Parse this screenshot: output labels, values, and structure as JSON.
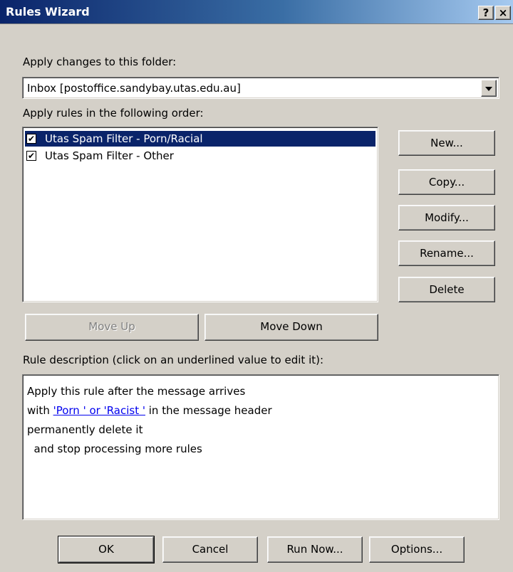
{
  "window": {
    "title": "Rules Wizard",
    "help_glyph": "?",
    "close_glyph": "×"
  },
  "folder": {
    "label": "Apply changes to this folder:",
    "value": "Inbox [postoffice.sandybay.utas.edu.au]"
  },
  "rules": {
    "label": "Apply rules in the following order:",
    "items": [
      {
        "label": "Utas Spam Filter - Porn/Racial",
        "checked": true,
        "selected": true
      },
      {
        "label": "Utas Spam Filter - Other",
        "checked": true,
        "selected": false
      }
    ]
  },
  "side_buttons": {
    "new": "New...",
    "copy": "Copy...",
    "modify": "Modify...",
    "rename": "Rename...",
    "delete": "Delete"
  },
  "move": {
    "up": "Move Up",
    "down": "Move Down"
  },
  "description": {
    "label": "Rule description (click on an underlined value to edit it):",
    "line1": "Apply this rule after the message arrives",
    "line2_prefix": "with ",
    "line2_link": "'Porn  ' or 'Racist  '",
    "line2_suffix": " in the message header",
    "line3": "permanently delete it",
    "line4": "  and stop processing more rules"
  },
  "footer": {
    "ok": "OK",
    "cancel": "Cancel",
    "run_now": "Run Now...",
    "options": "Options..."
  },
  "colors": {
    "face": "#d4d0c8",
    "selection": "#0a246a",
    "link": "#0000ee"
  }
}
